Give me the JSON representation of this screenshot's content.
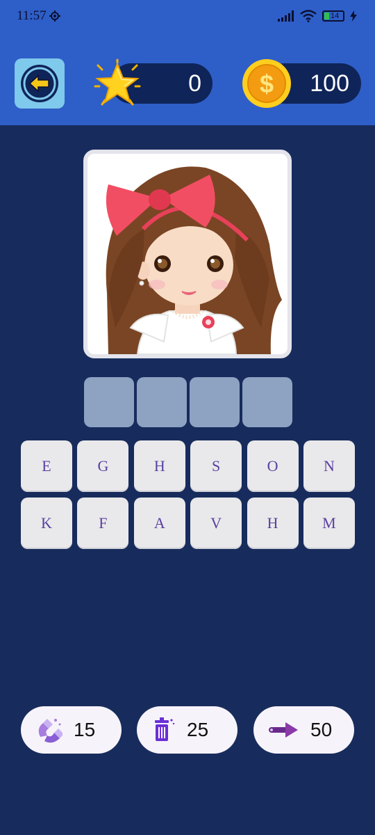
{
  "status_bar": {
    "time": "11:57",
    "battery": "14"
  },
  "header": {
    "stars": "0",
    "coins": "100"
  },
  "puzzle": {
    "answer_slots": [
      "",
      "",
      "",
      ""
    ],
    "letters": [
      "E",
      "G",
      "H",
      "S",
      "O",
      "N",
      "K",
      "F",
      "A",
      "V",
      "H",
      "M"
    ]
  },
  "powerups": {
    "reveal_cost": "15",
    "remove_cost": "25",
    "skip_cost": "50"
  },
  "colors": {
    "background": "#172c5c",
    "header": "#2e5ec8",
    "pill": "#0f2458",
    "slot": "#8ea2c2",
    "tile": "#e9e9eb",
    "letter": "#5b3fa0"
  }
}
